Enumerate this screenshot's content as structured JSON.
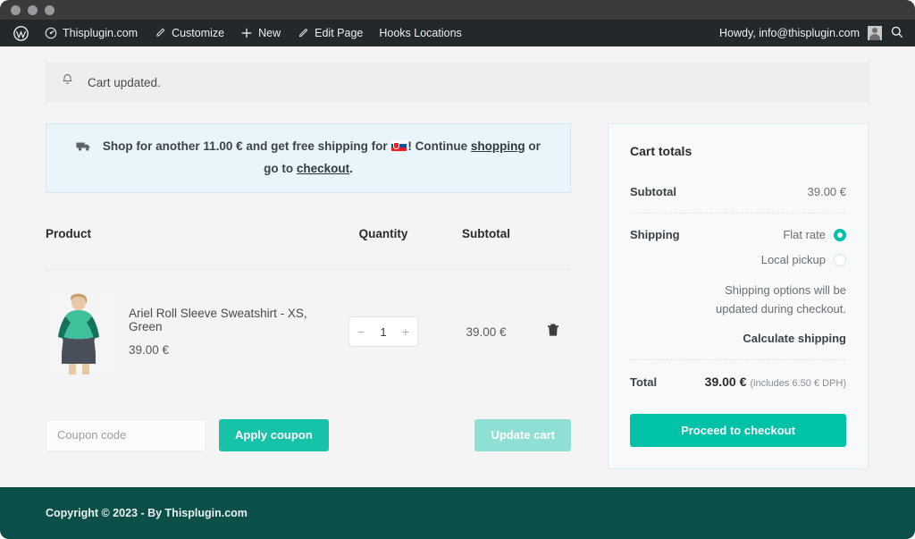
{
  "adminbar": {
    "site": "Thisplugin.com",
    "customize": "Customize",
    "new": "New",
    "edit_page": "Edit Page",
    "hooks_locations": "Hooks Locations",
    "howdy": "Howdy, info@thisplugin.com"
  },
  "notice": {
    "text": "Cart updated."
  },
  "shipping_notice": {
    "prefix": "Shop for another ",
    "amount": "11.00 €",
    "middle": " and get free shipping for ",
    "flag": "slovakia-flag",
    "exclaim": "! Continue ",
    "link_shopping": "shopping",
    "or": " or go to ",
    "link_checkout": "checkout",
    "period": "."
  },
  "table": {
    "headers": {
      "product": "Product",
      "quantity": "Quantity",
      "subtotal": "Subtotal"
    },
    "rows": [
      {
        "name": "Ariel Roll Sleeve Sweatshirt - XS, Green",
        "price": "39.00 €",
        "qty_minus": "−",
        "qty": "1",
        "qty_plus": "+",
        "subtotal": "39.00 €"
      }
    ]
  },
  "coupon": {
    "placeholder": "Coupon code",
    "value": "",
    "apply_label": "Apply coupon",
    "update_label": "Update cart"
  },
  "cart_totals": {
    "title": "Cart totals",
    "subtotal_label": "Subtotal",
    "subtotal_value": "39.00 €",
    "shipping_label": "Shipping",
    "options": [
      {
        "label": "Flat rate",
        "selected": true
      },
      {
        "label": "Local pickup",
        "selected": false
      }
    ],
    "note": "Shipping options will be updated during checkout.",
    "calculate_link": "Calculate shipping",
    "total_label": "Total",
    "total_value": "39.00 €",
    "total_tax": "(includes 6.50 € DPH)",
    "checkout_label": "Proceed to checkout"
  },
  "footer": {
    "copyright": "Copyright © 2023 - By Thisplugin.com"
  },
  "colors": {
    "accent": "#00c2a8",
    "accent_muted": "#8ee0d4",
    "footer": "#0c4f48",
    "adminbar": "#23282d",
    "notice_bg": "#e9f4fb"
  }
}
